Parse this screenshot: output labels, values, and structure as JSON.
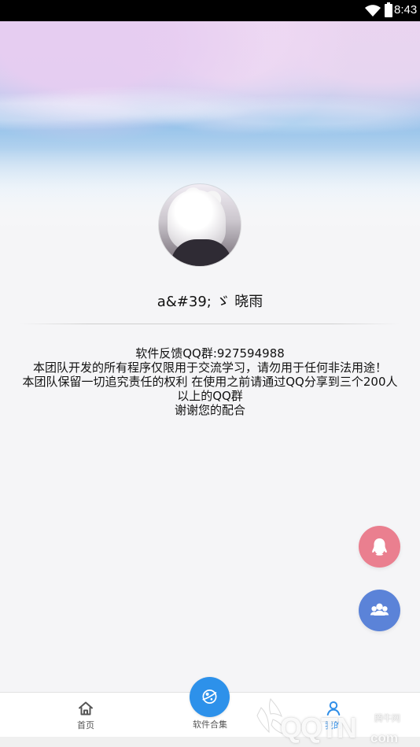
{
  "status_bar": {
    "time": "8:43",
    "wifi_icon": "wifi-icon",
    "battery_icon": "battery-icon"
  },
  "profile": {
    "username": "a&#39; ゞ 晓雨",
    "avatar_icon": "avatar-photo-icon"
  },
  "notice": {
    "line1": "软件反馈QQ群:927594988",
    "line2": "本团队开发的所有程序仅限用于交流学习，请勿用于任何非法用途！",
    "line3": "本团队保留一切追究责任的权利 在使用之前请通过QQ分享到三个200人以上的QQ群",
    "line4": "谢谢您的配合"
  },
  "floating_actions": {
    "qq_icon": "qq-icon",
    "group_icon": "group-icon",
    "qq_color": "#ea7f8f",
    "group_color": "#5b83d8"
  },
  "bottom_nav": {
    "items": [
      {
        "label": "首页",
        "icon": "home-icon"
      },
      {
        "label": "软件合集",
        "icon": "planet-icon"
      },
      {
        "label": "我的",
        "icon": "user-icon"
      }
    ],
    "active_color": "#2f8ee8",
    "center_color": "#2d91ea"
  },
  "watermark": {
    "brand": "QQTN",
    "domain": "com",
    "cn": "腾牛网",
    "logo_icon": "qqtn-logo-icon"
  }
}
